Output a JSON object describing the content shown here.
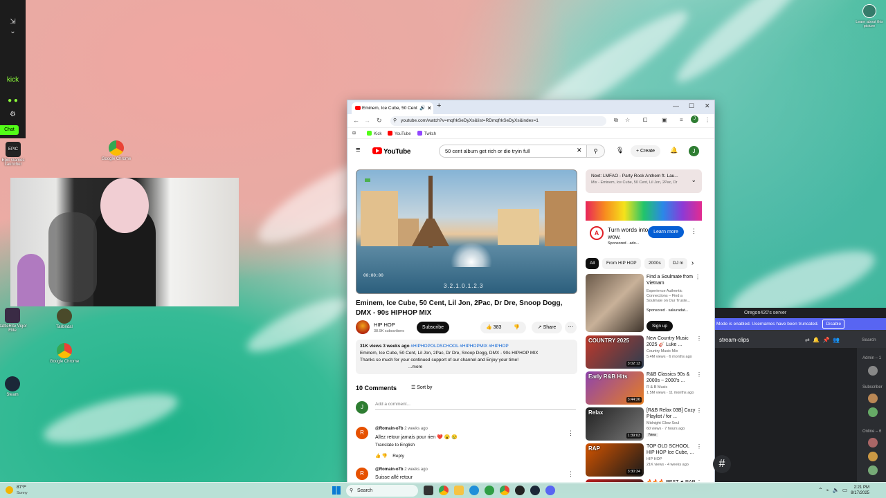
{
  "desktop": {
    "icons": [
      {
        "label": "Epic Games Launcher"
      },
      {
        "label": "Google Chrome"
      },
      {
        "label": "BattleRite Vigor Elite"
      },
      {
        "label": "Tailbridal"
      },
      {
        "label": "Google Chrome"
      },
      {
        "label": "Steam"
      }
    ],
    "learn_picture": "Learn about this picture"
  },
  "left_app": {
    "chat_label": "Chat"
  },
  "browser": {
    "tab_title": "Eminem, Ice Cube, 50 Cent",
    "url": "youtube.com/watch?v=mqfrkSeDyXs&list=RDmqfrkSeDyXs&index=1",
    "bookmarks": [
      {
        "label": "Kick",
        "color": "#53fc18"
      },
      {
        "label": "YouTube",
        "color": "#ff0000"
      },
      {
        "label": "Twitch",
        "color": "#9146ff"
      }
    ]
  },
  "youtube": {
    "logo": "YouTube",
    "search_value": "50 cent album get rich or die tryin full",
    "create_label": "Create",
    "user_initial": "J",
    "player": {
      "time": "00:00:00",
      "countdown": "3.2.1.0.1.2.3"
    },
    "video_title": "Eminem, Ice Cube, 50 Cent, Lil Jon, 2Pac, Dr Dre, Snoop Dogg, DMX - 90s HIPHOP MIX",
    "channel": {
      "name": "HIP HOP",
      "subs": "38.9K subscribers",
      "subscribe_label": "Subscribe"
    },
    "actions": {
      "likes": "383",
      "share": "Share"
    },
    "description": {
      "stats": "31K views  3 weeks ago",
      "tags": "#HIPHOPOLDSCHOOL #HIPHOPMIX #HIPHOP",
      "line1": "Eminem, Ice Cube, 50 Cent, Lil Jon, 2Pac, Dr Dre, Snoop Dogg, DMX - 90s HIPHOP MIX",
      "line2": "Thanks so much for your continued support of our channel and Enjoy your time!",
      "more": "...more"
    },
    "comments": {
      "count_label": "10 Comments",
      "sort_label": "Sort by",
      "add_placeholder": "Add a comment...",
      "items": [
        {
          "initial": "R",
          "author": "@Romain-o7b",
          "time": "2 weeks ago",
          "text": "Allez retour jamais pour rien ❤️ 😮 😢",
          "translate": "Translate to English",
          "reply": "Reply"
        },
        {
          "initial": "R",
          "author": "@Romain-o7b",
          "time": "2 weeks ago",
          "text": "Suisse allé retour"
        }
      ]
    },
    "next_up": {
      "title": "Next: LMFAO - Party Rock Anthem ft. Lau...",
      "sub": "Mix - Eminem, Ice Cube, 50 Cent, Lil Jon, 2Pac, Dr"
    },
    "ad": {
      "text": "Turn words into wow.",
      "meta": "Sponsored · ado...",
      "button": "Learn more",
      "logo": "A"
    },
    "chips": [
      "All",
      "From HIP HOP",
      "2000s",
      "DJ m"
    ],
    "sponsored_rec": {
      "title": "Find a Soulmate from Vietnam",
      "desc": "Experience Authentic Connections – Find a Soulmate on Our Truste...",
      "meta": "Sponsored · sakuradat...",
      "button": "Sign up"
    },
    "recommendations": [
      {
        "title": "New Country Music 2025 🎸 Luke ...",
        "channel": "Country Music Mix",
        "views": "5.4M views · 6 months ago",
        "duration": "3:02:13",
        "thumb_text": "COUNTRY 2025",
        "c1": "#c0392b",
        "c2": "#2c3e50"
      },
      {
        "title": "R&B Classics 90s & 2000s ~ 2000's ...",
        "channel": "R & B Music",
        "views": "1.5M views · 11 months ago",
        "duration": "3:44:26",
        "thumb_text": "Early R&B Hits",
        "c1": "#8e44ad",
        "c2": "#e67e22"
      },
      {
        "title": "[R&B Relax 03B] Cozy Playlist / for ...",
        "channel": "Midnight Glow Soul",
        "views": "60 views · 7 hours ago",
        "duration": "1:39:03",
        "badge": "New",
        "thumb_text": "Relax",
        "c1": "#222222",
        "c2": "#777777"
      },
      {
        "title": "TOP OLD SCHOOL HIP HOP Ice Cube, ...",
        "channel": "HIP HOP",
        "views": "21K views · 4 weeks ago",
        "duration": "3:30:34",
        "thumb_text": "RAP",
        "c1": "#d35400",
        "c2": "#1a1a1a"
      },
      {
        "title": "🔥🔥🔥 BEST ✦ RAP ...",
        "channel": "",
        "views": "",
        "duration": "",
        "thumb_text": "",
        "c1": "#b71c1c",
        "c2": "#222222"
      }
    ]
  },
  "discord": {
    "server": "Oregon420's server",
    "banner": "Mode is enabled. Usernames have been truncated.",
    "disable": "Disable",
    "channel": "stream-clips",
    "search": "Search",
    "sections": [
      "Admin – 1",
      "Subscriber",
      "Online – 6"
    ]
  },
  "taskbar": {
    "temp": "87°F",
    "condition": "Sunny",
    "search": "Search",
    "time": "2:21 PM",
    "date": "8/17/2025"
  }
}
